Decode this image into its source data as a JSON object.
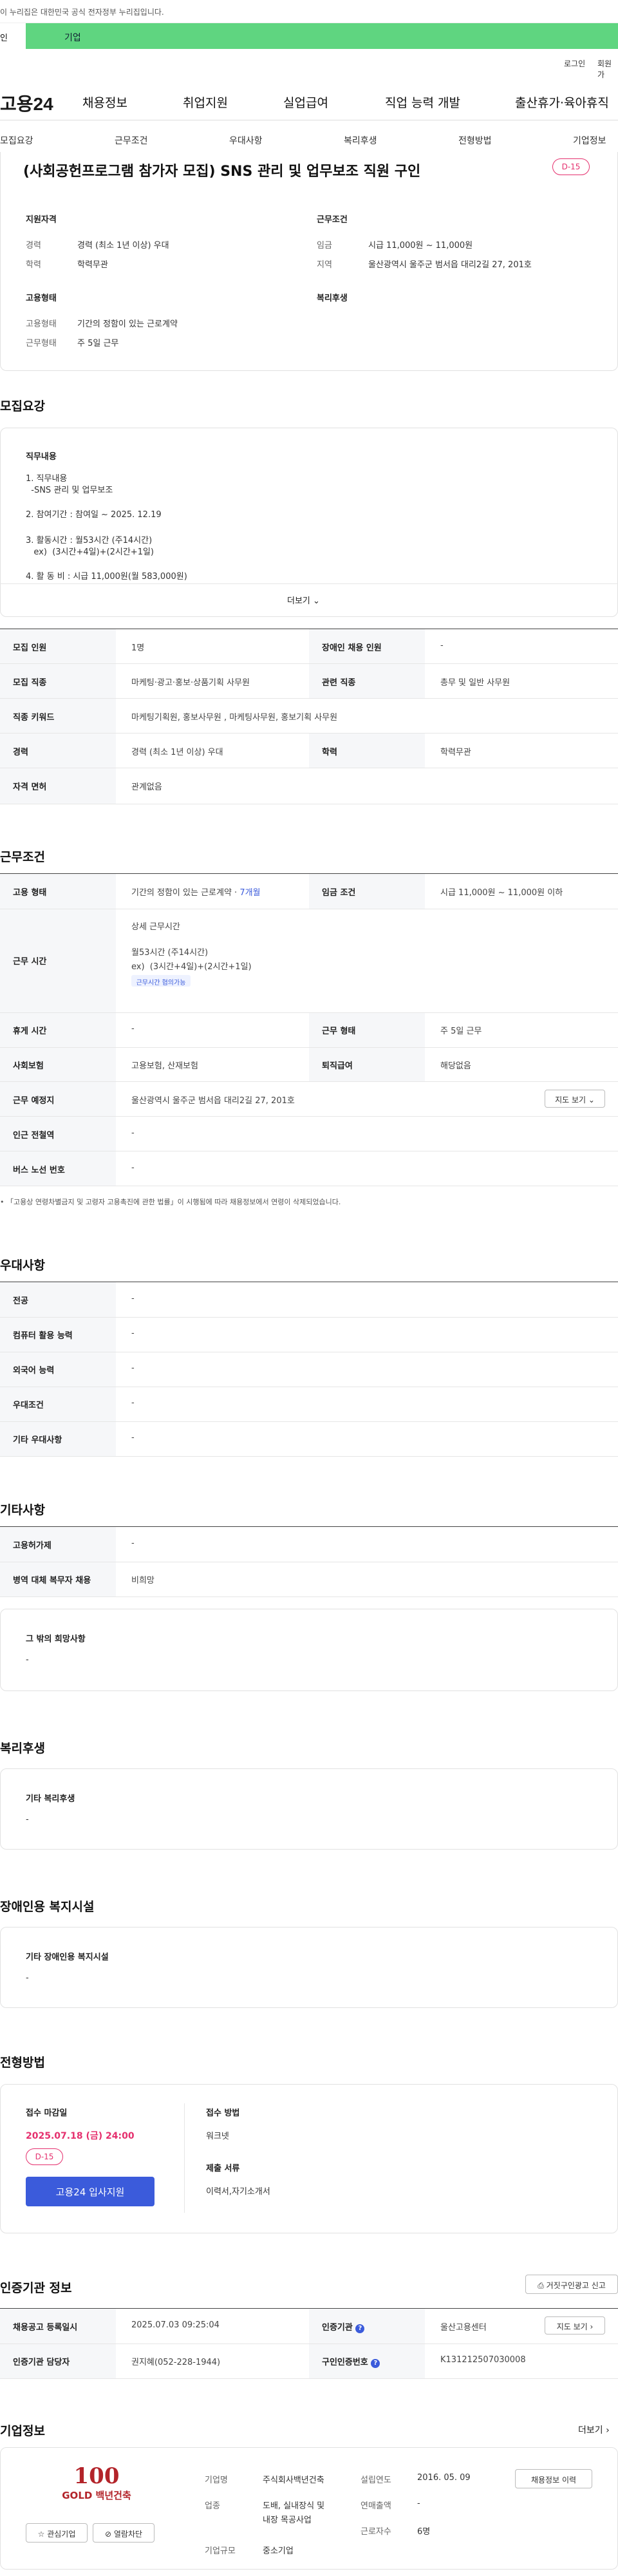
{
  "banner": {
    "text": "이 누리집은 대한민국 공식 전자정부 누리집입니다."
  },
  "tabs": {
    "left": "인",
    "right": "기업"
  },
  "util": {
    "login": "로그인",
    "join": "회원가"
  },
  "header": {
    "logo": "고용24",
    "gnb": [
      "채용정보",
      "취업지원",
      "실업급여",
      "직업 능력 개발",
      "출산휴가·육아휴직"
    ]
  },
  "subnav": [
    "모집요강",
    "근무조건",
    "우대사항",
    "복리후생",
    "전형방법",
    "기업정보"
  ],
  "job": {
    "title": "(사회공헌프로그램 참가자 모집) SNS 관리 및 업무보조 직원 구인",
    "dday": "D-15",
    "qual_h": "지원자격",
    "qual": [
      {
        "label": "경력",
        "value": "경력 (최소 1년 이상) 우대"
      },
      {
        "label": "학력",
        "value": "학력무관"
      }
    ],
    "cond_h": "근무조건",
    "cond": [
      {
        "label": "임금",
        "value": "시급 11,000원 ~ 11,000원"
      },
      {
        "label": "지역",
        "value": "울산광역시 울주군 범서읍 대리2길 27, 201호"
      }
    ],
    "emp_h": "고용형태",
    "emp": [
      {
        "label": "고용형태",
        "value": "기간의 정함이 있는 근로계약"
      },
      {
        "label": "근무형태",
        "value": "주 5일 근무"
      }
    ],
    "welfare_h": "복리후생"
  },
  "recruit": {
    "title": "모집요강",
    "duty_h": "직무내용",
    "duty_lines": [
      "1. 직무내용",
      "  -SNS 관리 및 업무보조",
      "2. 참여기간 : 참여일 ~ 2025. 12.19",
      "3. 활동시간 : 월53시간 (주14시간)",
      "   ex)  (3시간+4일)+(2시간+1일)",
      "4. 활 동 비 : 시급 11,000원(월 583,000원)"
    ],
    "more": "더보기",
    "rows": [
      {
        "h1": "모집 인원",
        "v1": "1명",
        "h2": "장애인 채용 인원",
        "v2": "-"
      },
      {
        "h1": "모집 직종",
        "v1": "마케팅·광고·홍보·상품기획 사무원",
        "h2": "관련 직종",
        "v2": "총무 및 일반 사무원"
      },
      {
        "h1": "직종 키워드",
        "v1": "마케팅기획원, 홍보사무원 , 마케팅사무원, 홍보기획 사무원"
      },
      {
        "h1": "경력",
        "v1": "경력 (최소 1년 이상) 우대",
        "h2": "학력",
        "v2": "학력무관"
      },
      {
        "h1": "자격 면허",
        "v1": "관계없음"
      }
    ]
  },
  "work": {
    "title": "근무조건",
    "emp_h": "고용 형태",
    "emp_v": "기간의 정함이 있는 근로계약 · ",
    "emp_period": "7개월",
    "wage_h": "임금 조건",
    "wage_v": "시급 11,000원 ~ 11,000원 이하",
    "time_h": "근무 시간",
    "time_lines": [
      "상세 근무시간",
      "월53시간 (주14시간)",
      "ex)  (3시간+4일)+(2시간+1일)"
    ],
    "time_pill": "근무시간 협의가능",
    "rest_h": "휴게 시간",
    "rest_v": "-",
    "type_h": "근무 형태",
    "type_v": "주 5일 근무",
    "ins_h": "사회보험",
    "ins_v": "고용보험, 산재보험",
    "sev_h": "퇴직급여",
    "sev_v": "해당없음",
    "place_h": "근무 예정지",
    "place_v": "울산광역시 울주군 범서읍 대리2길 27, 201호",
    "map_btn": "지도 보기",
    "sub_h": "인근 전철역",
    "sub_v": "-",
    "bus_h": "버스 노선 번호",
    "bus_v": "-",
    "note": "「고용상 연령차별금지 및 고령자 고용촉진에 관한 법률」이 시행됨에 따라 채용정보에서 연령이 삭제되었습니다."
  },
  "pref": {
    "title": "우대사항",
    "rows": [
      {
        "h": "전공",
        "v": "-"
      },
      {
        "h": "컴퓨터 활용 능력",
        "v": "-"
      },
      {
        "h": "외국어 능력",
        "v": "-"
      },
      {
        "h": "우대조건",
        "v": "-"
      },
      {
        "h": "기타 우대사항",
        "v": "-"
      }
    ]
  },
  "etc": {
    "title": "기타사항",
    "rows": [
      {
        "h": "고용허가제",
        "v": "-"
      },
      {
        "h": "병역 대체 복무자 채용",
        "v": "비희망"
      }
    ],
    "hope_h": "그 밖의 희망사항",
    "hope_v": "-"
  },
  "welfare": {
    "title": "복리후생",
    "h": "기타 복리후생",
    "v": "-"
  },
  "disab": {
    "title": "장애인용 복지시설",
    "h": "기타 장애인용 복지시설",
    "v": "-"
  },
  "screen": {
    "title": "전형방법",
    "deadline_h": "접수 마감일",
    "deadline_v": "2025.07.18 (금) 24:00",
    "dday": "D-15",
    "apply_btn": "고용24 입사지원",
    "method_h": "접수 방법",
    "method_v": "워크넷",
    "docs_h": "제출 서류",
    "docs_v": "이력서,자기소개서"
  },
  "cert": {
    "title": "인증기관 정보",
    "report_btn": "거짓구인광고 신고",
    "rows": [
      {
        "h1": "채용공고 등록일시",
        "v1": "2025.07.03 09:25:04",
        "h2": "인증기관",
        "v2": "울산고용센터"
      },
      {
        "h1": "인증기관 담당자",
        "v1": "권지혜(052-228-1944)",
        "h2": "구인인증번호",
        "v2": "K131212507030008"
      }
    ],
    "map_btn": "지도 보기"
  },
  "company": {
    "title": "기업정보",
    "more": "더보기",
    "logo_text": "100",
    "logo_sub": "GOLD 백년건축",
    "fav_btn": "관심기업",
    "block_btn": "열람차단",
    "name_h": "기업명",
    "name_v": "주식회사백년건축",
    "ind_h": "업종",
    "ind_v1": "도배, 실내장식 및",
    "ind_v2": "내장 목공사업",
    "size_h": "기업규모",
    "size_v": "중소기업",
    "est_h": "설립연도",
    "est_v": "2016. 05. 09",
    "sales_h": "연매출액",
    "sales_v": "-",
    "emp_h": "근로자수",
    "emp_v": "6명",
    "hist_btn": "채용정보 이력"
  },
  "colors": {
    "brand_green": "#5fd580",
    "accent_blue": "#3b5bdb",
    "dday_red": "#e5306e"
  }
}
